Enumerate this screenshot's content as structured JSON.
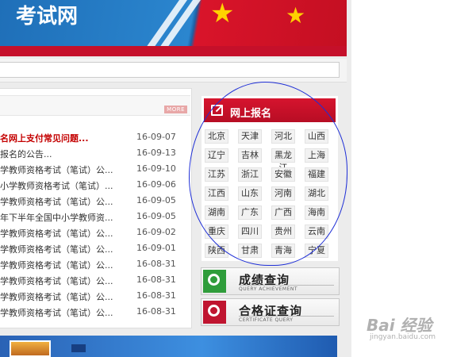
{
  "banner": {
    "title_fragment": "考试网"
  },
  "news": {
    "more_label": "MORE",
    "items": [
      {
        "title": "名网上支付常见问题...",
        "date": "16-09-07",
        "highlight": true
      },
      {
        "title": "报名的公告...",
        "date": "16-09-13"
      },
      {
        "title": "学教师资格考试（笔试）公...",
        "date": "16-09-10"
      },
      {
        "title": "小学教师资格考试（笔试）...",
        "date": "16-09-06"
      },
      {
        "title": "学教师资格考试（笔试）公...",
        "date": "16-09-05"
      },
      {
        "title": "年下半年全国中小学教师资...",
        "date": "16-09-05"
      },
      {
        "title": "学教师资格考试（笔试）公...",
        "date": "16-09-02"
      },
      {
        "title": "学教师资格考试（笔试）公...",
        "date": "16-09-01"
      },
      {
        "title": "学教师资格考试（笔试）公...",
        "date": "16-08-31"
      },
      {
        "title": "学教师资格考试（笔试）公...",
        "date": "16-08-31"
      },
      {
        "title": "学教师资格考试（笔试）公...",
        "date": "16-08-31"
      },
      {
        "title": "学教师资格考试（笔试）公...",
        "date": "16-08-31"
      }
    ]
  },
  "registration": {
    "title": "网上报名",
    "provinces": [
      [
        "北京",
        "天津",
        "河北",
        "山西"
      ],
      [
        "辽宁",
        "吉林",
        "黑龙江",
        "上海"
      ],
      [
        "江苏",
        "浙江",
        "安徽",
        "福建"
      ],
      [
        "江西",
        "山东",
        "河南",
        "湖北"
      ],
      [
        "湖南",
        "广东",
        "广西",
        "海南"
      ],
      [
        "重庆",
        "四川",
        "贵州",
        "云南"
      ],
      [
        "陕西",
        "甘肃",
        "青海",
        "宁夏"
      ]
    ]
  },
  "query": {
    "score": {
      "cn": "成绩查询",
      "en": "QUERY ACHIEVEMENT"
    },
    "certificate": {
      "cn": "合格证查询",
      "en": "CERTIFICATE QUERY"
    }
  },
  "watermark": {
    "brand": "Bai 经验",
    "site": "jingyan.baidu.com"
  },
  "colors": {
    "brand_red": "#c5102a",
    "annotation_blue": "#1f2fd6",
    "query_green": "#2f9d3b"
  }
}
